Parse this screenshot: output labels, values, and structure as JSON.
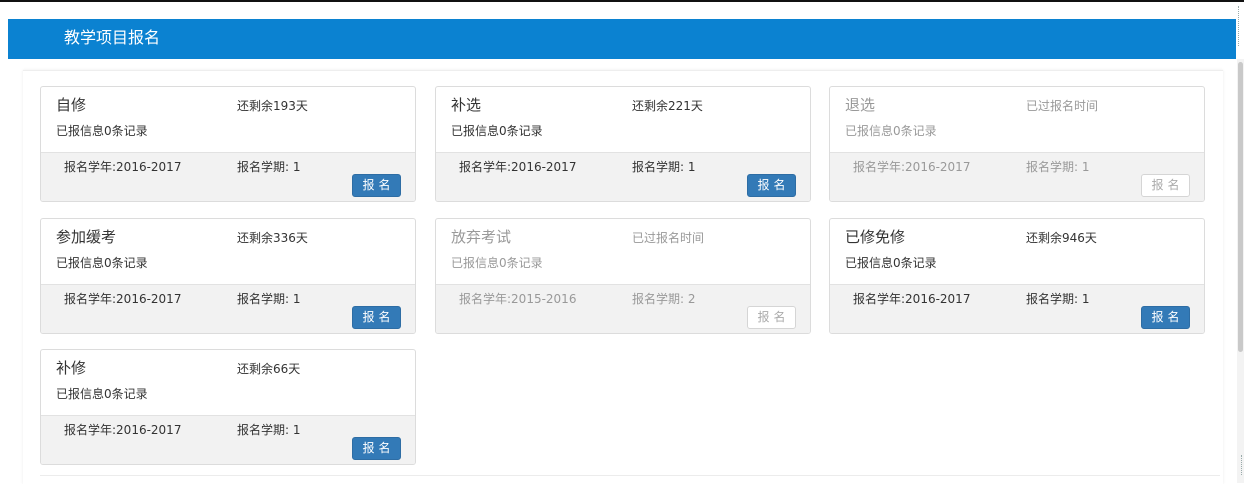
{
  "header": {
    "title": "教学项目报名"
  },
  "cards": [
    {
      "name": "自修",
      "remaining": "还剩余193天",
      "info": "已报信息0条记录",
      "year": "报名学年:2016-2017",
      "term": "报名学期: 1",
      "button": "报名",
      "state": "active"
    },
    {
      "name": "补选",
      "remaining": "还剩余221天",
      "info": "已报信息0条记录",
      "year": "报名学年:2016-2017",
      "term": "报名学期: 1",
      "button": "报名",
      "state": "active"
    },
    {
      "name": "退选",
      "remaining": "已过报名时间",
      "info": "已报信息0条记录",
      "year": "报名学年:2016-2017",
      "term": "报名学期: 1",
      "button": "报名",
      "state": "expired"
    },
    {
      "name": "参加缓考",
      "remaining": "还剩余336天",
      "info": "已报信息0条记录",
      "year": "报名学年:2016-2017",
      "term": "报名学期: 1",
      "button": "报名",
      "state": "active"
    },
    {
      "name": "放弃考试",
      "remaining": "已过报名时间",
      "info": "已报信息0条记录",
      "year": "报名学年:2015-2016",
      "term": "报名学期: 2",
      "button": "报名",
      "state": "expired"
    },
    {
      "name": "已修免修",
      "remaining": "还剩余946天",
      "info": "已报信息0条记录",
      "year": "报名学年:2016-2017",
      "term": "报名学期: 1",
      "button": "报名",
      "state": "active"
    },
    {
      "name": "补修",
      "remaining": "还剩余66天",
      "info": "已报信息0条记录",
      "year": "报名学年:2016-2017",
      "term": "报名学期: 1",
      "button": "报名",
      "state": "active"
    }
  ],
  "colors": {
    "header": "#0b82d1",
    "button": "#337ab7",
    "footer": "#f2f2f2"
  }
}
